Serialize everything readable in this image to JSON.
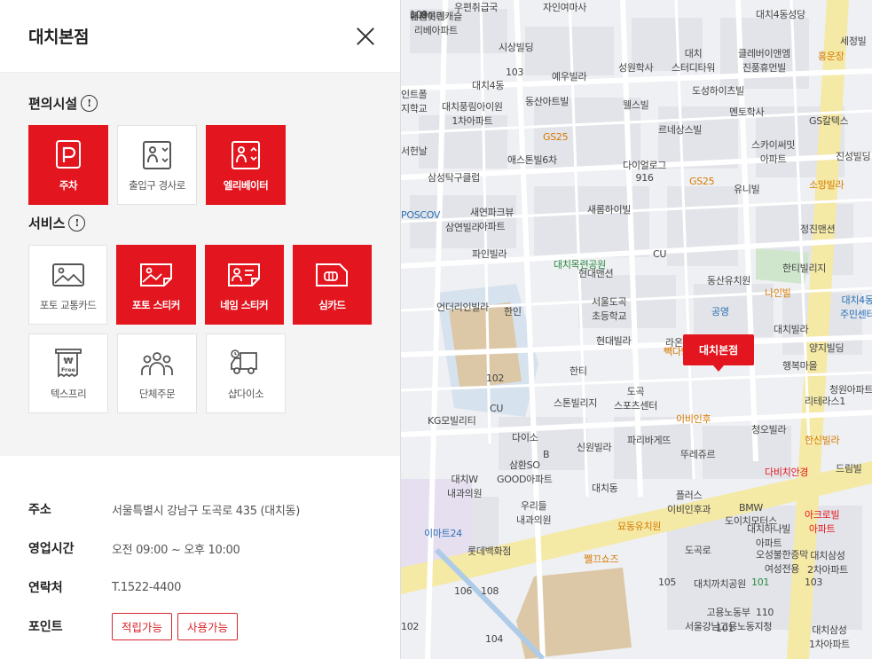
{
  "panel": {
    "title": "대치본점",
    "facilities_title": "편의시설",
    "services_title": "서비스",
    "info_glyph": "!",
    "facilities": [
      {
        "label": "주차",
        "icon": "parking-icon",
        "active": true
      },
      {
        "label": "출입구 경사로",
        "icon": "ramp-icon",
        "active": false
      },
      {
        "label": "엘리베이터",
        "icon": "elevator-icon",
        "active": true
      }
    ],
    "services": [
      {
        "label": "포토 교통카드",
        "icon": "photo-card-icon",
        "active": false
      },
      {
        "label": "포토 스티커",
        "icon": "photo-sticker-icon",
        "active": true
      },
      {
        "label": "네임 스티커",
        "icon": "name-sticker-icon",
        "active": true
      },
      {
        "label": "심카드",
        "icon": "sim-card-icon",
        "active": true
      },
      {
        "label": "텍스프리",
        "icon": "tax-free-icon",
        "active": false
      },
      {
        "label": "단체주문",
        "icon": "group-order-icon",
        "active": false
      },
      {
        "label": "샵다이소",
        "icon": "delivery-truck-icon",
        "active": false
      }
    ],
    "info": {
      "address_label": "주소",
      "address": "서울특별시 강남구 도곡로 435 (대치동)",
      "hours_label": "영업시간",
      "hours": "오전 09:00 ~ 오후 10:00",
      "contact_label": "연락처",
      "contact": "T.1522-4400",
      "points_label": "포인트",
      "points_chips": [
        "적립가능",
        "사용가능"
      ]
    },
    "tax_free_tag": "Free",
    "tax_free_currency": "₩"
  },
  "colors": {
    "accent": "#e3161f",
    "map_road_major": "#f5e9a6",
    "map_bg": "#eef0f3"
  },
  "map": {
    "marker_label": "대치본점",
    "labels": [
      "우편취급국",
      "자인여마사",
      "대치4동성당",
      "세정빌",
      "시상빌딩",
      "103",
      "대치4동",
      "예우빌라",
      "성원학사",
      "대치\n스터디타워",
      "클레버이앤엠\n진풍휴먼빌",
      "홍운장",
      "인트폴\n지학교",
      "대치풍림아이원\n1차아파트",
      "동산아트빌",
      "웰스빌",
      "도성하이츠빌",
      "멘토학사",
      "GS칼텍스",
      "GS25",
      "르네상스빌",
      "스카이써밋\n아파트",
      "진성빌딩",
      "서헌날",
      "애스톤빌6차",
      "다이얼로그\n916",
      "GS25",
      "유니빌",
      "소망빌라",
      "삼성탁구클럽",
      "정진맨션",
      "POSCOV",
      "새연파크뷰\n아파트",
      "삼연빌라",
      "새롬하이빌",
      "한티빌리지",
      "파인빌라",
      "대치목련공원",
      "현대맨션",
      "CU",
      "동산유치원",
      "나인빌",
      "대치4동\n주민센터",
      "언더리인빌라",
      "한인",
      "서울도곡\n초등학교",
      "공영",
      "대치빌라",
      "현대빌라",
      "양지빌딩",
      "행복마을",
      "라온빌",
      "빽다방",
      "102",
      "한티",
      "도곡\n스포츠센터",
      "스톤빌리지",
      "리테라스1",
      "청원아파트",
      "CU",
      "이비인후",
      "청오빌라",
      "KG모빌리티",
      "다이소",
      "파리바게뜨",
      "한신빌라",
      "신원빌라",
      "뚜레쥬르",
      "B",
      "다비치안경",
      "삼환SO\nGOOD아파트",
      "드림빌",
      "대치W\n내과의원",
      "대치동",
      "우리들\n내과의원",
      "플러스\n이비인후과",
      "BMW\n도이치모터스",
      "아크로빌\n아파트",
      "이마트24",
      "묘동유치원",
      "롯데백화점",
      "쩰끄쇼즈",
      "대치하나빌\n아파트",
      "도곡로",
      "오성불한증막\n여성전용",
      "대치삼성\n2차아파트",
      "105",
      "대치까치공원",
      "101",
      "103",
      "106",
      "108",
      "110",
      "고용노동부\n서울강남고용노동지청",
      "101",
      "대치삼성\n1차아파트",
      "102",
      "104",
      "109",
      "한울어린",
      "대치롯데캐슬\n리베아파트",
      "101"
    ]
  }
}
